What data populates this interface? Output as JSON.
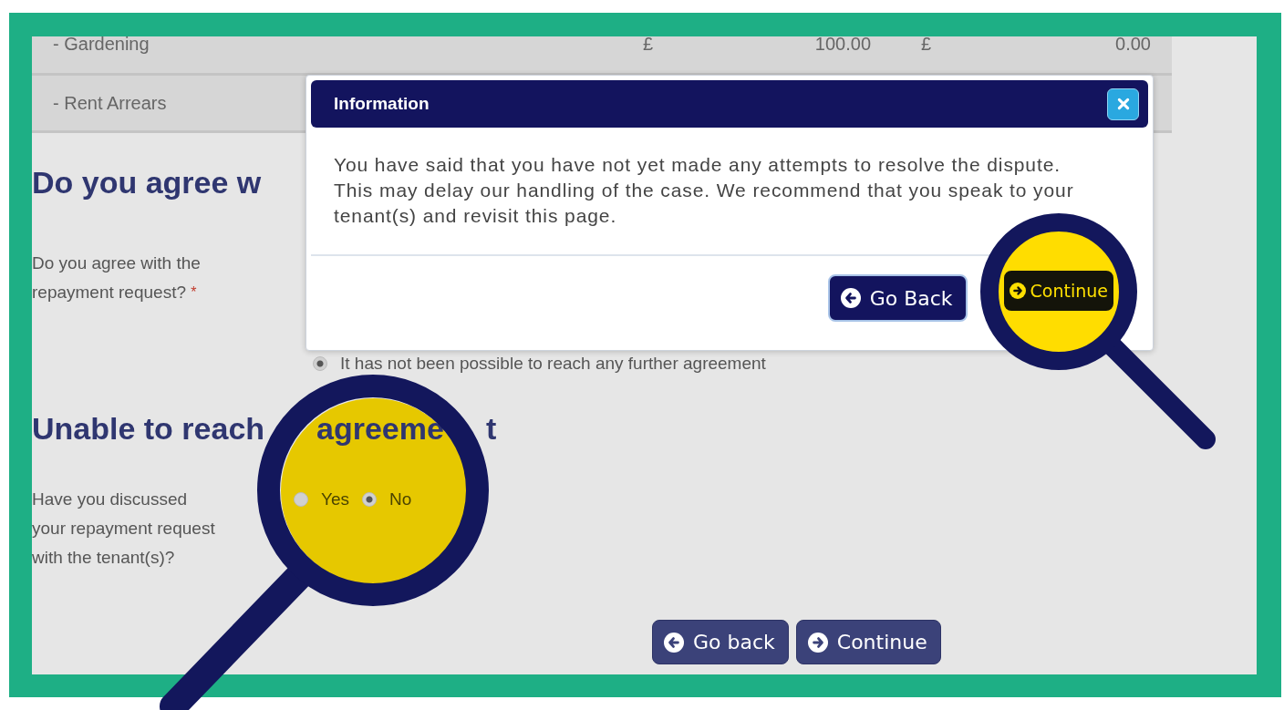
{
  "table": {
    "rows": [
      {
        "cells": [
          "- Gardening",
          "£",
          "100.00",
          "£",
          "0.00"
        ]
      },
      {
        "cells": [
          "- Rent Arrears"
        ]
      }
    ]
  },
  "agree_section": {
    "heading": "Do you agree w",
    "question": {
      "label": "Do you agree with the repayment request?",
      "required_mark": "*"
    },
    "option": {
      "label": "It has not been possible to reach any further agreement",
      "selected": true
    }
  },
  "unable_section": {
    "heading_parts": [
      "Unable to reach",
      "agreeme",
      "t"
    ],
    "question": {
      "label": "Have you discussed your repayment request with the tenant(s)?"
    },
    "options": [
      {
        "label": "Yes",
        "selected": false
      },
      {
        "label": "No",
        "selected": true
      }
    ]
  },
  "buttons": [
    {
      "label": "Go back",
      "kind": "back"
    },
    {
      "label": "Continue",
      "kind": "forward"
    }
  ],
  "dialog": {
    "title": "Information",
    "message": "You have said that you have not yet made any attempts to resolve the dispute. This may delay our handling of the case. We recommend that you speak to your tenant(s) and revisit this page.",
    "buttons": [
      {
        "label": "Go Back",
        "kind": "back"
      },
      {
        "label": "Continue",
        "kind": "forward"
      }
    ]
  }
}
